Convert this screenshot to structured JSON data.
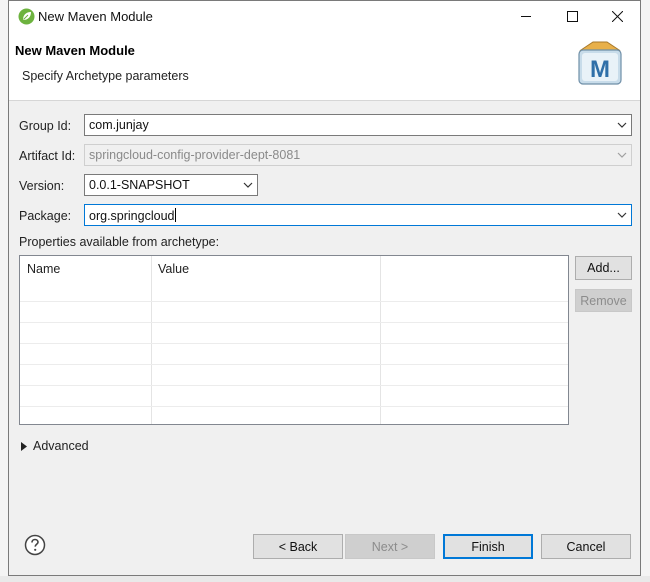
{
  "window": {
    "title": "New Maven Module"
  },
  "header": {
    "title": "New Maven Module",
    "subtitle": "Specify Archetype parameters"
  },
  "form": {
    "group_id": {
      "label": "Group Id:",
      "value": "com.junjay"
    },
    "artifact_id": {
      "label": "Artifact Id:",
      "value": "springcloud-config-provider-dept-8081"
    },
    "version": {
      "label": "Version:",
      "value": "0.0.1-SNAPSHOT"
    },
    "package": {
      "label": "Package:",
      "value": "org.springcloud"
    }
  },
  "properties": {
    "label": "Properties available from archetype:",
    "columns": [
      "Name",
      "Value"
    ],
    "add_label": "Add...",
    "remove_label": "Remove"
  },
  "advanced": {
    "label": "Advanced"
  },
  "footer": {
    "back_label": "< Back",
    "next_label": "Next >",
    "finish_label": "Finish",
    "cancel_label": "Cancel"
  },
  "icons": {
    "app": "spring-leaf-icon",
    "banner": "maven-icon",
    "help": "help-icon"
  },
  "colors": {
    "accent": "#0078d7",
    "spring_green": "#6db33f"
  }
}
